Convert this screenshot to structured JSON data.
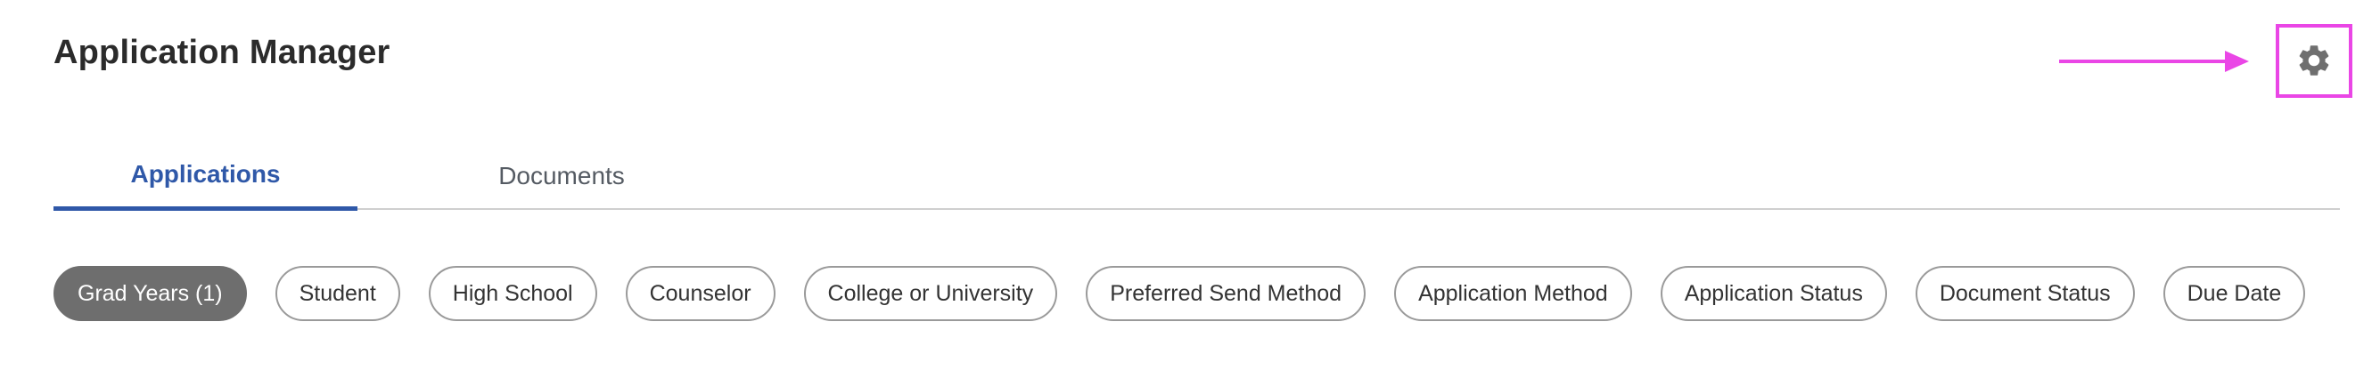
{
  "header": {
    "title": "Application Manager",
    "settings_icon": "gear-icon"
  },
  "tabs": [
    {
      "label": "Applications",
      "active": true
    },
    {
      "label": "Documents",
      "active": false
    }
  ],
  "filters": [
    {
      "label": "Grad Years (1)",
      "active": true
    },
    {
      "label": "Student",
      "active": false
    },
    {
      "label": "High School",
      "active": false
    },
    {
      "label": "Counselor",
      "active": false
    },
    {
      "label": "College or University",
      "active": false
    },
    {
      "label": "Preferred Send Method",
      "active": false
    },
    {
      "label": "Application Method",
      "active": false
    },
    {
      "label": "Application Status",
      "active": false
    },
    {
      "label": "Document Status",
      "active": false
    },
    {
      "label": "Due Date",
      "active": false
    }
  ],
  "colors": {
    "accent": "#2f58a8",
    "annotation": "#ea46e6",
    "active_chip": "#6e6e6e",
    "icon": "#6f6f6f"
  }
}
